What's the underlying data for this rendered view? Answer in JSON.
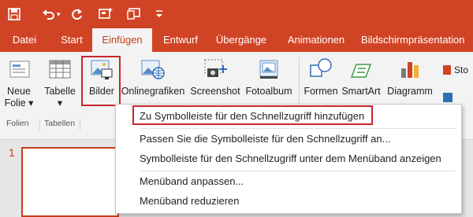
{
  "qat": {
    "icons": [
      "save-icon",
      "undo-icon",
      "redo-icon",
      "new-slide-icon",
      "customize-qat-icon"
    ]
  },
  "tabs": [
    {
      "label": "Datei"
    },
    {
      "label": "Start"
    },
    {
      "label": "Einfügen"
    },
    {
      "label": "Entwurf"
    },
    {
      "label": "Übergänge"
    },
    {
      "label": "Animationen"
    },
    {
      "label": "Bildschirmpräsentation"
    }
  ],
  "ribbon": {
    "buttons": {
      "neue_folie": "Neue\nFolie ▾",
      "tabelle": "Tabelle\n▾",
      "bilder": "Bilder",
      "onlinegrafiken": "Onlinegrafiken",
      "screenshot": "Screenshot",
      "fotoalbum": "Fotoalbum",
      "formen": "Formen",
      "smartart": "SmartArt",
      "diagramm": "Diagramm",
      "store": "Sto"
    },
    "groups": {
      "folien": "Folien",
      "tabellen": "Tabellen"
    }
  },
  "slides": {
    "number": "1"
  },
  "menu": {
    "items": [
      {
        "label": "Zu Symbolleiste für den Schnellzugriff hinzufügen"
      },
      {
        "label": "Passen Sie die Symbolleiste für den Schnellzugriff an..."
      },
      {
        "label": "Symbolleiste für den Schnellzugriff unter dem Menüband anzeigen"
      },
      {
        "label": "Menüband anpassen..."
      },
      {
        "label": "Menüband reduzieren"
      }
    ]
  },
  "colors": {
    "accent": "#d04425",
    "highlight_box": "#c8262c"
  }
}
